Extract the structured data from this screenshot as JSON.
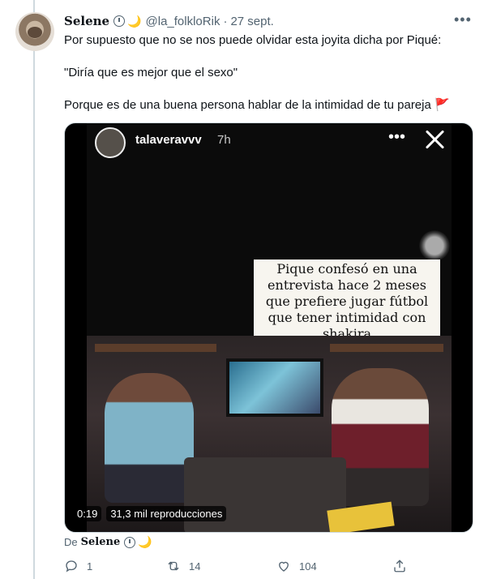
{
  "tweet": {
    "author_name": "Selene",
    "author_handle": "@la_folkloRik",
    "separator": "·",
    "date": "27 sept.",
    "more_label": "•••",
    "moon_emoji": "🌙",
    "text_line1": "Por supuesto que no se nos puede olvidar esta joyita dicha por Piqué:",
    "text_line2": "\"Diría que es mejor que el sexo\"",
    "text_line3": "Porque es de una buena persona hablar de la intimidad de tu pareja",
    "flag_emoji": "🚩"
  },
  "media": {
    "story_user": "talaveravvv",
    "story_time": "7h",
    "story_more": "•••",
    "caption": "Pique confesó en una entrevista hace 2 meses que prefiere jugar fútbol que tener intimidad con shakira",
    "video_time": "0:19",
    "video_views": "31,3 mil reproducciones"
  },
  "attribution": {
    "prefix": "De",
    "name": "Selene"
  },
  "actions": {
    "reply_count": "1",
    "retweet_count": "14",
    "like_count": "104"
  },
  "icons": [
    "clock-icon",
    "moon-icon",
    "more-icon",
    "close-icon",
    "reply-icon",
    "retweet-icon",
    "like-icon",
    "share-icon",
    "flag-icon"
  ],
  "colors": {
    "secondary_text": "#536471",
    "thread_line": "#cfd9de",
    "flag": "#d93025"
  }
}
